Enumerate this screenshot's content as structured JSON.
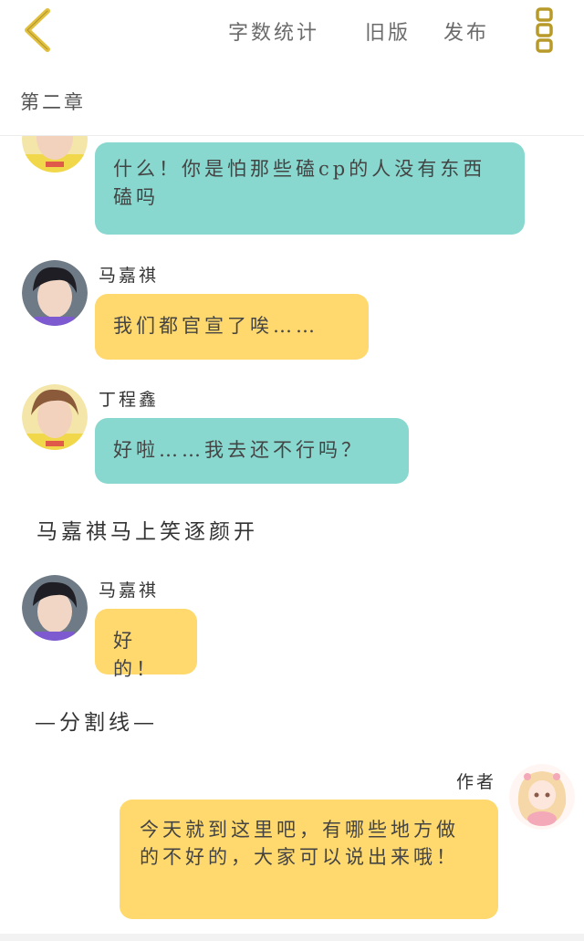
{
  "toolbar": {
    "word_count": "字数统计",
    "old_version": "旧版",
    "publish": "发布"
  },
  "chapter": {
    "title": "第二章"
  },
  "messages": [
    {
      "speaker": "",
      "text": "什么！你是怕那些磕cp的人没有东西磕吗",
      "color": "teal"
    },
    {
      "speaker": "马嘉祺",
      "text": "我们都官宣了唉……",
      "color": "yellow"
    },
    {
      "speaker": "丁程鑫",
      "text": "好啦……我去还不行吗？",
      "color": "teal"
    },
    {
      "narration": "马嘉祺马上笑逐颜开"
    },
    {
      "speaker": "马嘉祺",
      "text": "好的！",
      "color": "yellow"
    },
    {
      "narration": "—分割线—"
    },
    {
      "speaker": "作者",
      "text": "今天就到这里吧，有哪些地方做的不好的，大家可以说出来哦！",
      "color": "yellow"
    }
  ],
  "colors": {
    "accent": "#e8c23a",
    "teal_bubble": "#88d8cf",
    "yellow_bubble": "#ffd96e"
  },
  "icons": {
    "back": "chevron-left-icon",
    "more": "vertical-dots-icon"
  }
}
